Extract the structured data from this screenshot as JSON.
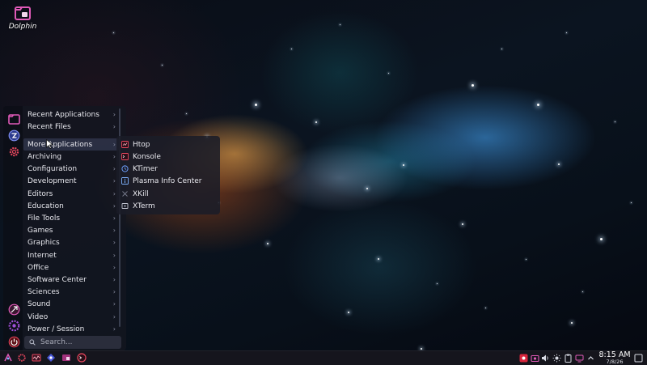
{
  "desktop": {
    "icon_label": "Dolphin"
  },
  "menu": {
    "categories": [
      {
        "label": "Recent Applications"
      },
      {
        "label": "Recent Files"
      },
      {
        "label": "More Applications"
      },
      {
        "label": "Archiving"
      },
      {
        "label": "Configuration"
      },
      {
        "label": "Development"
      },
      {
        "label": "Editors"
      },
      {
        "label": "Education"
      },
      {
        "label": "File Tools"
      },
      {
        "label": "Games"
      },
      {
        "label": "Graphics"
      },
      {
        "label": "Internet"
      },
      {
        "label": "Office"
      },
      {
        "label": "Software Center"
      },
      {
        "label": "Sciences"
      },
      {
        "label": "Sound"
      },
      {
        "label": "Video"
      },
      {
        "label": "Power / Session"
      }
    ],
    "active_category": "More Applications",
    "search_placeholder": "Search..."
  },
  "submenu": {
    "items": [
      {
        "label": "Htop",
        "icon": "htop-icon"
      },
      {
        "label": "Konsole",
        "icon": "konsole-icon"
      },
      {
        "label": "KTimer",
        "icon": "ktimer-icon"
      },
      {
        "label": "Plasma Info Center",
        "icon": "info-center-icon"
      },
      {
        "label": "XKill",
        "icon": "xkill-icon"
      },
      {
        "label": "XTerm",
        "icon": "xterm-icon"
      }
    ]
  },
  "clock": {
    "time": "8:15 AM",
    "date": "7/8/26"
  },
  "colors": {
    "accent": "#e05ab8",
    "panel": "#14161f",
    "taskbar": "#16161e"
  }
}
